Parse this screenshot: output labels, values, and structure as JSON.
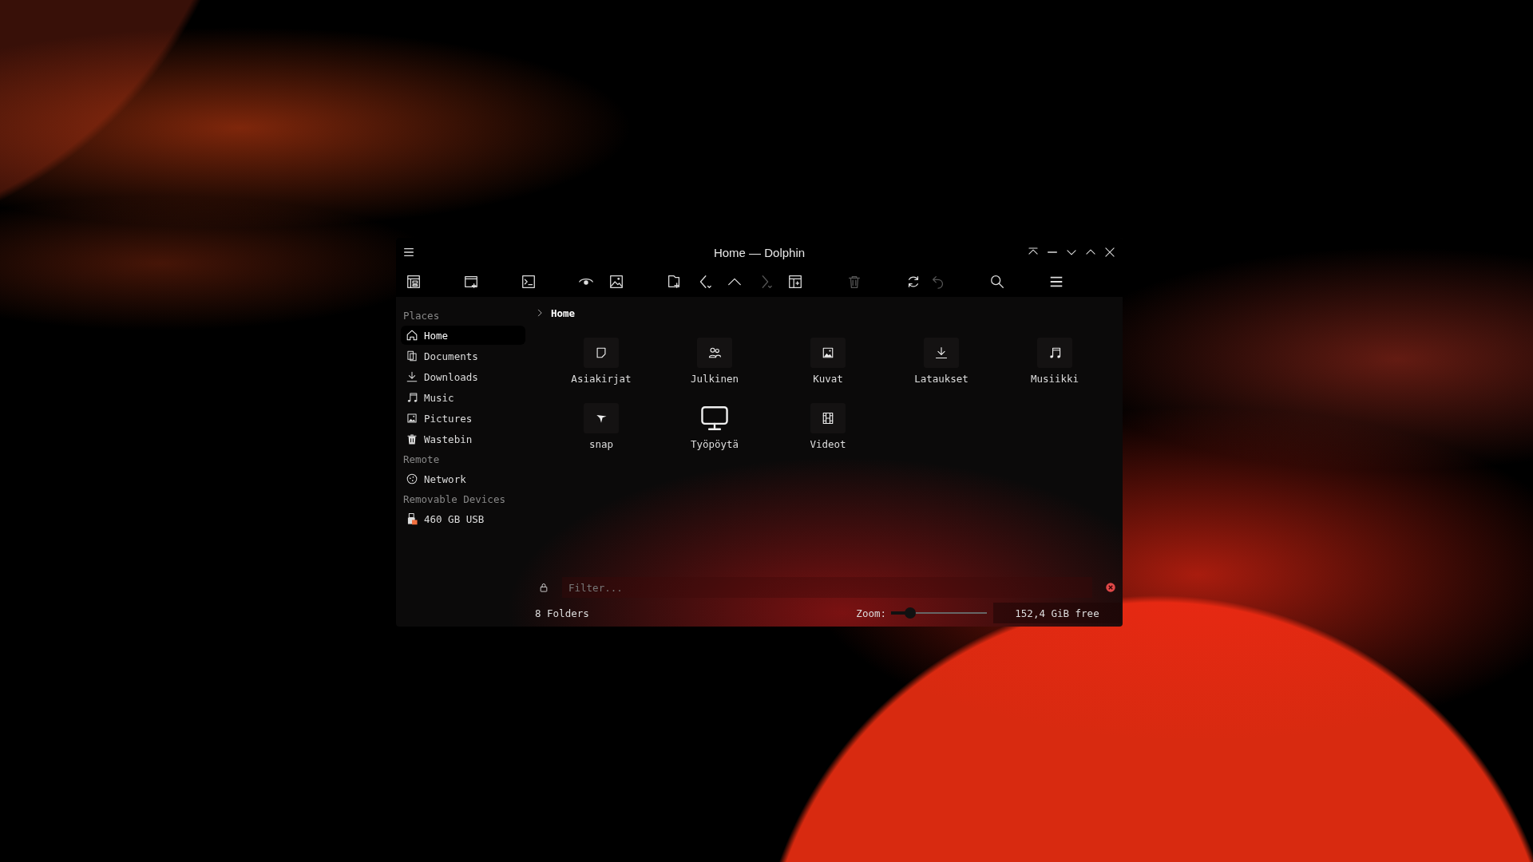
{
  "window": {
    "title": "Home — Dolphin"
  },
  "toolbar_buttons": [
    {
      "disabled": false
    },
    {
      "disabled": false
    },
    {
      "disabled": false
    },
    {
      "disabled": false
    },
    {
      "disabled": false
    },
    {
      "disabled": false
    },
    {
      "disabled": false
    },
    {
      "disabled": false
    },
    {
      "disabled": true
    },
    {
      "disabled": false
    },
    {
      "disabled": true
    },
    {
      "disabled": false
    },
    {
      "disabled": true
    },
    {
      "disabled": false
    },
    {
      "disabled": false
    }
  ],
  "sidebar": {
    "sections": [
      {
        "title": "Places",
        "items": [
          {
            "label": "Home",
            "selected": true
          },
          {
            "label": "Documents",
            "selected": false
          },
          {
            "label": "Downloads",
            "selected": false
          },
          {
            "label": "Music",
            "selected": false
          },
          {
            "label": "Pictures",
            "selected": false
          },
          {
            "label": "Wastebin",
            "selected": false
          }
        ]
      },
      {
        "title": "Remote",
        "items": [
          {
            "label": "Network",
            "selected": false
          }
        ]
      },
      {
        "title": "Removable Devices",
        "items": [
          {
            "label": "460 GB USB",
            "selected": false
          }
        ]
      }
    ]
  },
  "breadcrumb": {
    "location": "Home"
  },
  "folders": [
    {
      "name": "Asiakirjat"
    },
    {
      "name": "Julkinen"
    },
    {
      "name": "Kuvat"
    },
    {
      "name": "Lataukset"
    },
    {
      "name": "Musiikki"
    },
    {
      "name": "snap"
    },
    {
      "name": "Työpöytä"
    },
    {
      "name": "Videot"
    }
  ],
  "filter": {
    "placeholder": "Filter..."
  },
  "status_bar": {
    "summary": "8 Folders",
    "zoom_label": "Zoom:",
    "zoom": {
      "level": 0.2
    },
    "free_space": "152,4 GiB free"
  }
}
